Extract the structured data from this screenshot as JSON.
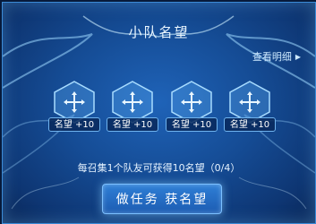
{
  "panel": {
    "title": "小队名望",
    "details_link": "查看明细"
  },
  "slots": [
    {
      "reward": "名望 +10",
      "icon": "add-member-icon"
    },
    {
      "reward": "名望 +10",
      "icon": "add-member-icon"
    },
    {
      "reward": "名望 +10",
      "icon": "add-member-icon"
    },
    {
      "reward": "名望 +10",
      "icon": "add-member-icon"
    }
  ],
  "progress_text": "每召集1个队友可获得10名望（0/4）",
  "cta_label": "做任务 获名望",
  "colors": {
    "panel_bg": "#154c95",
    "border": "#3b8ad6",
    "text": "#eaf6ff",
    "button": "#2f7fd6"
  }
}
